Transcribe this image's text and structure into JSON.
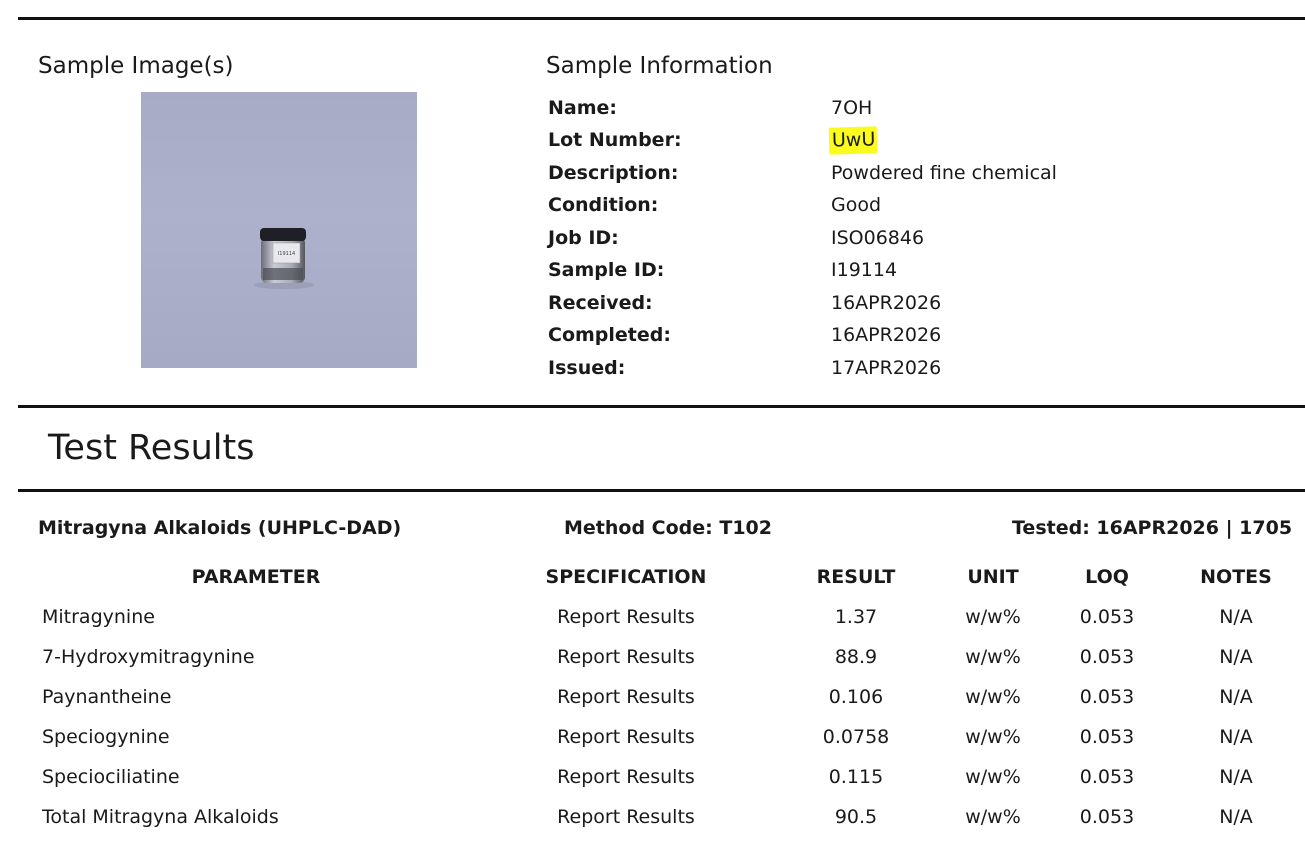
{
  "sample_images": {
    "heading": "Sample Image(s)",
    "vial_label": "I19114"
  },
  "sample_info": {
    "heading": "Sample Information",
    "fields": [
      {
        "label": "Name:",
        "value": "7OH"
      },
      {
        "label": "Lot Number:",
        "value": "UwU",
        "highlight": "#fbfb1e"
      },
      {
        "label": "Description:",
        "value": "Powdered fine chemical"
      },
      {
        "label": "Condition:",
        "value": "Good"
      },
      {
        "label": "Job ID:",
        "value": "ISO06846"
      },
      {
        "label": "Sample ID:",
        "value": "I19114"
      },
      {
        "label": "Received:",
        "value": "16APR2026"
      },
      {
        "label": "Completed:",
        "value": "16APR2026"
      },
      {
        "label": "Issued:",
        "value": "17APR2026"
      }
    ]
  },
  "test_results": {
    "heading": "Test Results",
    "section": {
      "title": "Mitragyna Alkaloids (UHPLC-DAD)",
      "method": "Method Code: T102",
      "tested": "Tested: 16APR2026 | 1705"
    },
    "columns": [
      "PARAMETER",
      "SPECIFICATION",
      "RESULT",
      "UNIT",
      "LOQ",
      "NOTES"
    ],
    "rows": [
      {
        "parameter": "Mitragynine",
        "specification": "Report Results",
        "result": "1.37",
        "unit": "w/w%",
        "loq": "0.053",
        "notes": "N/A"
      },
      {
        "parameter": "7-Hydroxymitragynine",
        "specification": "Report Results",
        "result": "88.9",
        "unit": "w/w%",
        "loq": "0.053",
        "notes": "N/A"
      },
      {
        "parameter": "Paynantheine",
        "specification": "Report Results",
        "result": "0.106",
        "unit": "w/w%",
        "loq": "0.053",
        "notes": "N/A"
      },
      {
        "parameter": "Speciogynine",
        "specification": "Report Results",
        "result": "0.0758",
        "unit": "w/w%",
        "loq": "0.053",
        "notes": "N/A"
      },
      {
        "parameter": "Speciociliatine",
        "specification": "Report Results",
        "result": "0.115",
        "unit": "w/w%",
        "loq": "0.053",
        "notes": "N/A"
      },
      {
        "parameter": "Total Mitragyna Alkaloids",
        "specification": "Report Results",
        "result": "90.5",
        "unit": "w/w%",
        "loq": "0.053",
        "notes": "N/A"
      }
    ]
  }
}
